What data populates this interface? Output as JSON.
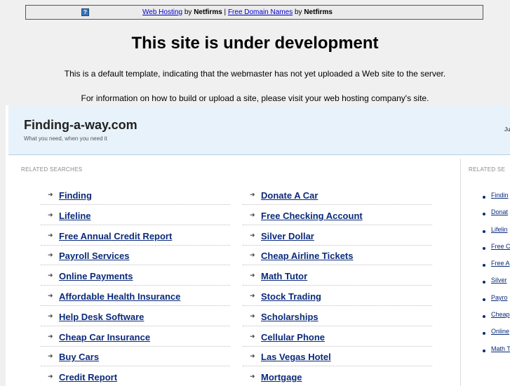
{
  "banner": {
    "icon_label": "?",
    "link1": "Web Hosting",
    "by1": " by ",
    "brand1": "Netfirms",
    "sep": " | ",
    "link2": "Free Domain Names",
    "by2": " by ",
    "brand2": "Netfirms"
  },
  "notice": {
    "title": "This site is under development",
    "line1": "This is a default template, indicating that the webmaster has not yet uploaded a Web site to the server.",
    "line2": "For information on how to build or upload a site, please visit your web hosting company's site."
  },
  "site": {
    "name": "Finding-a-way.com",
    "tagline": "What you need, when you need it",
    "header_right": "Ju"
  },
  "related": {
    "label": "RELATED SEARCHES",
    "right_label": "RELATED SE",
    "column1": [
      "Finding",
      "Lifeline",
      "Free Annual Credit Report",
      "Payroll Services",
      "Online Payments",
      "Affordable Health Insurance",
      "Help Desk Software",
      "Cheap Car Insurance",
      "Buy Cars",
      "Credit Report"
    ],
    "column2": [
      "Donate A Car",
      "Free Checking Account",
      "Silver Dollar",
      "Cheap Airline Tickets",
      "Math Tutor",
      "Stock Trading",
      "Scholarships",
      "Cellular Phone",
      "Las Vegas Hotel",
      "Mortgage"
    ],
    "sidebar": [
      "Findin",
      "Donat",
      "Lifelin",
      "Free C",
      "Free A",
      "Silver",
      "Payro",
      "Cheap",
      "Online",
      "Math T"
    ]
  }
}
